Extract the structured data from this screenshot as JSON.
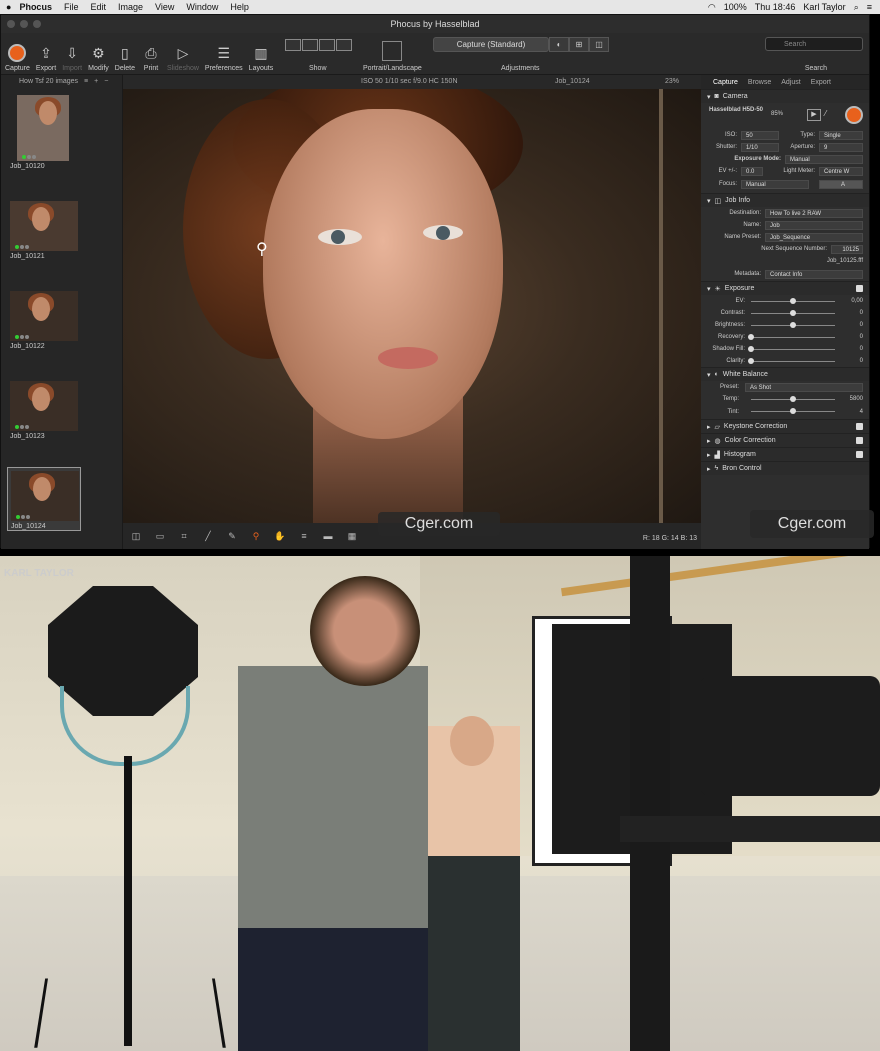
{
  "menubar": {
    "app": "Phocus",
    "items": [
      "File",
      "Edit",
      "Image",
      "View",
      "Window",
      "Help"
    ],
    "battery": "100%",
    "clock": "Thu 18:46",
    "user": "Karl Taylor"
  },
  "window": {
    "title": "Phocus by Hasselblad"
  },
  "toolbar": {
    "items": [
      {
        "label": "Capture"
      },
      {
        "label": "Export"
      },
      {
        "label": "Import"
      },
      {
        "label": "Modify"
      },
      {
        "label": "Delete"
      },
      {
        "label": "Print"
      },
      {
        "label": "Slideshow"
      },
      {
        "label": "Preferences"
      },
      {
        "label": "Layouts"
      }
    ],
    "show": "Show",
    "portrait": "Portrait/Landscape",
    "capture_mode": "Capture (Standard)",
    "adjustments": "Adjustments",
    "search_placeholder": "Search",
    "search_label": "Search"
  },
  "browser": {
    "header": "How Tsf 20 images",
    "thumbs": [
      {
        "name": "Job_10120"
      },
      {
        "name": "Job_10121"
      },
      {
        "name": "Job_10122"
      },
      {
        "name": "Job_10123"
      },
      {
        "name": "Job_10124"
      }
    ]
  },
  "viewer": {
    "exif": "ISO 50   1/10 sec   f/9.0   HC 150N",
    "filename": "Job_10124",
    "zoom": "23%",
    "rgb": "R:  18  G:  14  B:  13"
  },
  "panel": {
    "tabs": [
      "Capture",
      "Browse",
      "Adjust",
      "Export"
    ],
    "camera": {
      "title": "Camera",
      "model": "Hasselblad H5D-50",
      "battery": "85%",
      "iso_label": "ISO:",
      "iso": "50",
      "type_label": "Type:",
      "type": "Single",
      "shutter_label": "Shutter:",
      "shutter": "1/10",
      "aperture_label": "Aperture:",
      "aperture": "9",
      "mode_label": "Exposure Mode:",
      "mode": "Manual",
      "ev_label": "EV +/-:",
      "ev": "0.0",
      "meter_label": "Light Meter:",
      "meter": "Centre W",
      "focus_label": "Focus:",
      "focus": "Manual"
    },
    "job": {
      "title": "Job Info",
      "dest_label": "Destination:",
      "dest": "How To live 2 RAW",
      "name_label": "Name:",
      "name": "Job",
      "preset_label": "Name Preset:",
      "preset": "Job_Sequence",
      "next_label": "Next Sequence Number:",
      "next": "10125",
      "file": "Job_10125.fff",
      "meta_label": "Metadata:",
      "meta": "Contact Info"
    },
    "exposure": {
      "title": "Exposure",
      "rows": [
        {
          "label": "EV:",
          "value": "0,00",
          "pos": 0.5
        },
        {
          "label": "Contrast:",
          "value": "0",
          "pos": 0.5
        },
        {
          "label": "Brightness:",
          "value": "0",
          "pos": 0.5
        },
        {
          "label": "Recovery:",
          "value": "0",
          "pos": 0
        },
        {
          "label": "Shadow Fill:",
          "value": "0",
          "pos": 0
        },
        {
          "label": "Clarity:",
          "value": "0",
          "pos": 0
        }
      ]
    },
    "wb": {
      "title": "White Balance",
      "preset_label": "Preset:",
      "preset": "As Shot",
      "temp_label": "Temp:",
      "temp": "5800",
      "tint_label": "Tint:",
      "tint": "4",
      "temp_pos": 0.5,
      "tint_pos": 0.5
    },
    "collapsed": [
      "Keystone Correction",
      "Color Correction",
      "Histogram",
      "Bron Control"
    ]
  },
  "watermark": "Cger.com",
  "studio": {
    "brand": "KARL TAYLOR"
  }
}
